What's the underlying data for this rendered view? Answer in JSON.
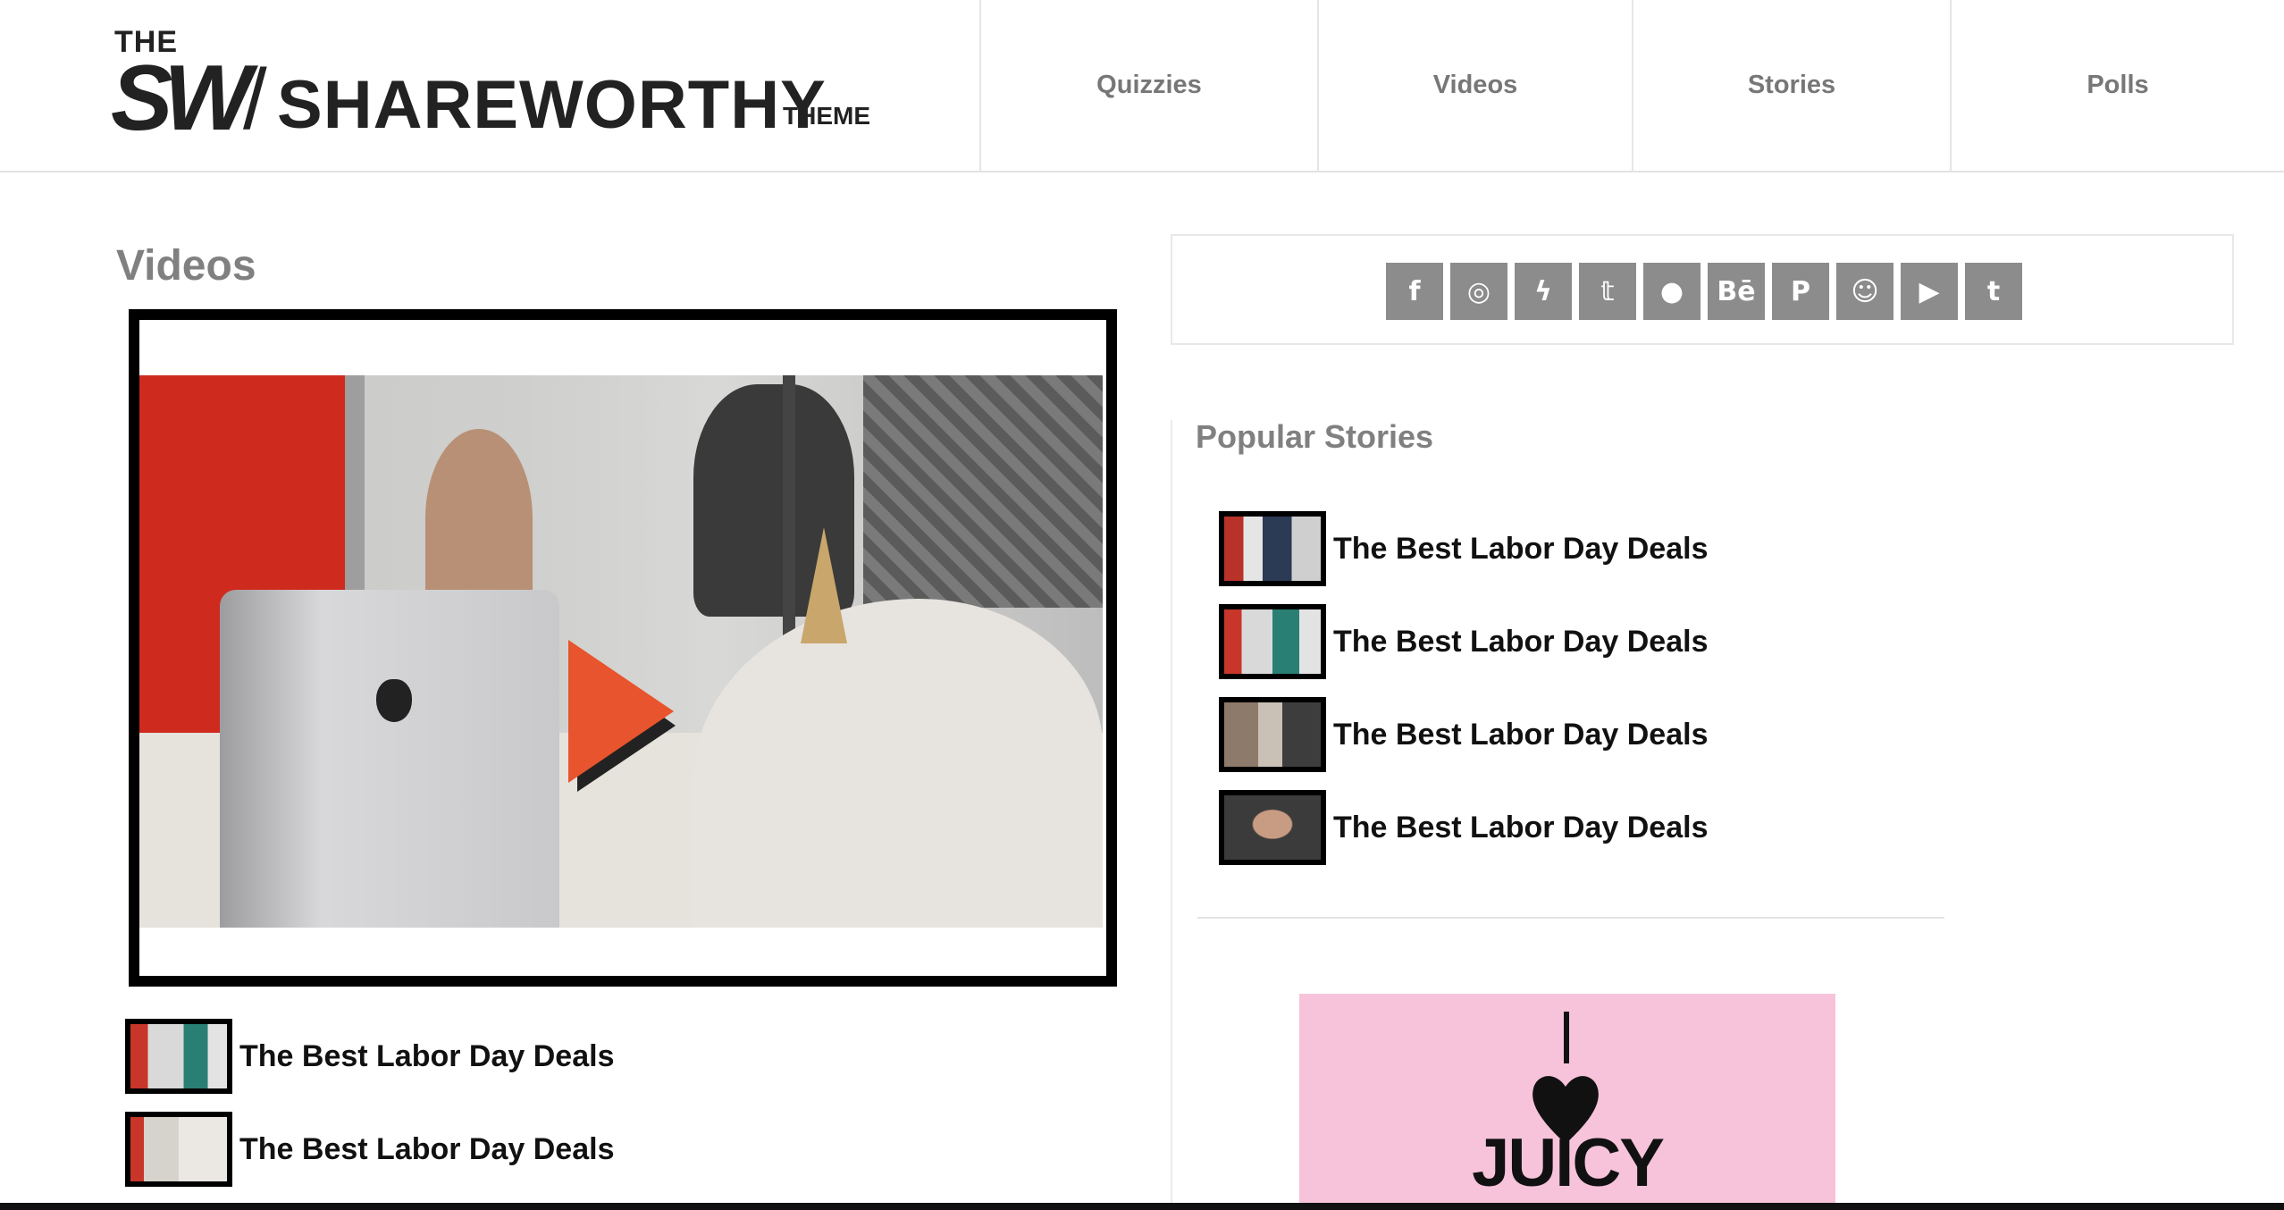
{
  "brand": {
    "the": "THE",
    "sw": "SW",
    "slash": "/",
    "name": "SHAREWORTHY",
    "theme": "THEME"
  },
  "nav": [
    {
      "label": "Quizzies"
    },
    {
      "label": "Videos"
    },
    {
      "label": "Stories"
    },
    {
      "label": "Polls"
    }
  ],
  "main": {
    "section_title": "Videos",
    "video": {
      "play_icon": "play-icon"
    },
    "related": [
      {
        "title": "The Best Labor Day Deals"
      },
      {
        "title": "The Best Labor Day Deals"
      }
    ]
  },
  "sidebar": {
    "social": [
      {
        "name": "facebook-icon",
        "glyph": "f"
      },
      {
        "name": "instagram-icon",
        "glyph": "◎"
      },
      {
        "name": "deviantart-icon",
        "glyph": "ϟ"
      },
      {
        "name": "twitter-icon",
        "glyph": "𝕥"
      },
      {
        "name": "github-icon",
        "glyph": "●"
      },
      {
        "name": "behance-icon",
        "glyph": "Bē"
      },
      {
        "name": "pinterest-icon",
        "glyph": "P"
      },
      {
        "name": "snapchat-icon",
        "glyph": "☺"
      },
      {
        "name": "youtube-icon",
        "glyph": "▶"
      },
      {
        "name": "tumblr-icon",
        "glyph": "t"
      }
    ],
    "popular_title": "Popular Stories",
    "popular": [
      {
        "title": "The Best Labor Day Deals"
      },
      {
        "title": "The Best Labor Day Deals"
      },
      {
        "title": "The Best Labor Day Deals"
      },
      {
        "title": "The Best Labor Day Deals"
      }
    ],
    "ad": {
      "text": "JUICY"
    }
  },
  "colors": {
    "accent": "#e8542d",
    "nav_text": "#777777",
    "muted_heading": "#808080",
    "social_bg": "#8c8c8c",
    "ad_bg": "#f6c3da"
  }
}
